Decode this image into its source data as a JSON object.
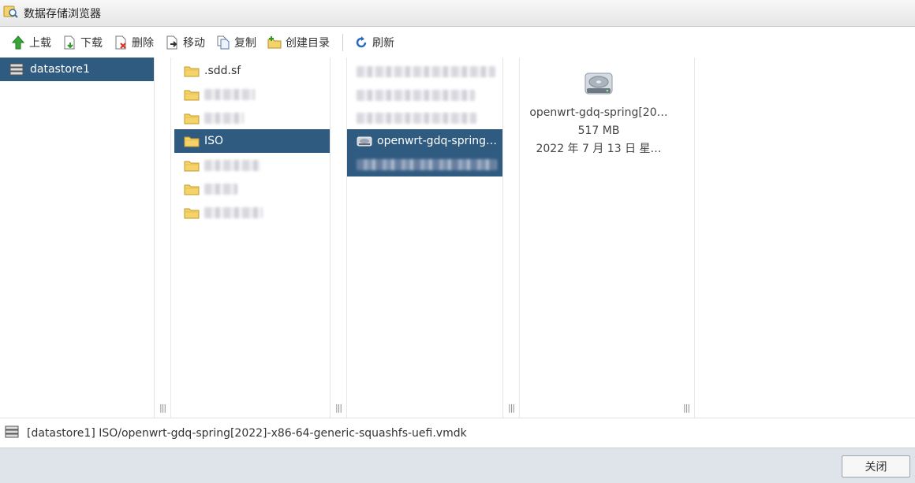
{
  "window": {
    "title": "数据存储浏览器",
    "icon": "datastore-browser-icon"
  },
  "toolbar": {
    "upload": "上载",
    "download": "下载",
    "delete": "删除",
    "move": "移动",
    "copy": "复制",
    "mkdir": "创建目录",
    "refresh": "刷新"
  },
  "pane1": {
    "items": [
      {
        "label": "datastore1",
        "selected": true
      }
    ]
  },
  "pane2": {
    "items": [
      {
        "label": ".sdd.sf",
        "blurred": false
      },
      {
        "label": "",
        "blurred": true
      },
      {
        "label": "",
        "blurred": true
      },
      {
        "label": "ISO",
        "blurred": false,
        "selected": true
      },
      {
        "label": "",
        "blurred": true
      },
      {
        "label": "",
        "blurred": true
      },
      {
        "label": "",
        "blurred": true
      }
    ]
  },
  "pane3": {
    "items": [
      {
        "label": "",
        "blurred": true
      },
      {
        "label": "",
        "blurred": true
      },
      {
        "label": "",
        "blurred": true
      },
      {
        "label": "openwrt-gdq-spring…",
        "blurred": false,
        "selected": true
      },
      {
        "label": "",
        "blurred": true,
        "selected": true
      }
    ]
  },
  "details": {
    "name": "openwrt-gdq-spring[20…",
    "size": "517 MB",
    "date": "2022 年 7 月 13 日 星…",
    "icon": "disk-file-icon"
  },
  "status": {
    "path": "[datastore1] ISO/openwrt-gdq-spring[2022]-x86-64-generic-squashfs-uefi.vmdk"
  },
  "footer": {
    "close": "关闭"
  },
  "colors": {
    "selection": "#305b80",
    "footer_bg": "#dfe3ea"
  }
}
